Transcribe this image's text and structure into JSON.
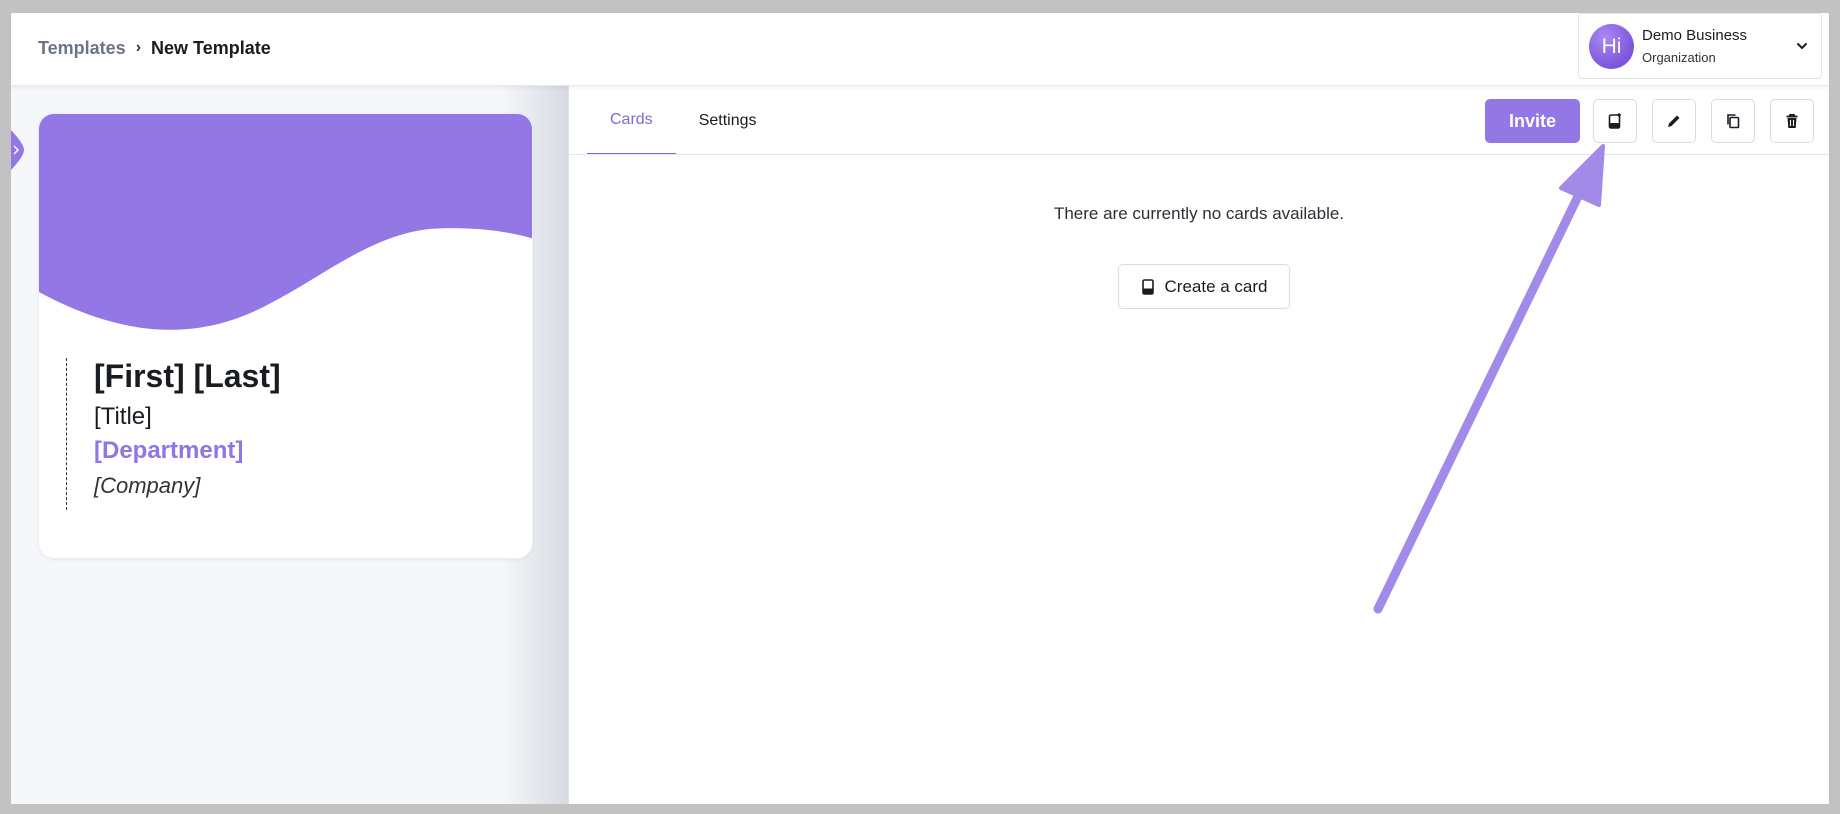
{
  "breadcrumb": {
    "root": "Templates",
    "separator": "›",
    "current": "New Template"
  },
  "org": {
    "avatar_text": "Hi",
    "name": "Demo Business",
    "type": "Organization",
    "icon": "chevron-down-icon"
  },
  "card": {
    "name": "[First] [Last]",
    "title": "[Title]",
    "department": "[Department]",
    "company": "[Company]",
    "accent_color": "#9277e5"
  },
  "tabs": [
    {
      "label": "Cards",
      "active": true
    },
    {
      "label": "Settings",
      "active": false
    }
  ],
  "toolbar": {
    "invite_label": "Invite",
    "icons": [
      "add-card-icon",
      "edit-icon",
      "duplicate-icon",
      "delete-icon"
    ]
  },
  "main": {
    "empty_message": "There are currently no cards available.",
    "create_label": "Create a card"
  },
  "colors": {
    "accent": "#9277e5",
    "annotation_arrow": "#a18ae8"
  }
}
